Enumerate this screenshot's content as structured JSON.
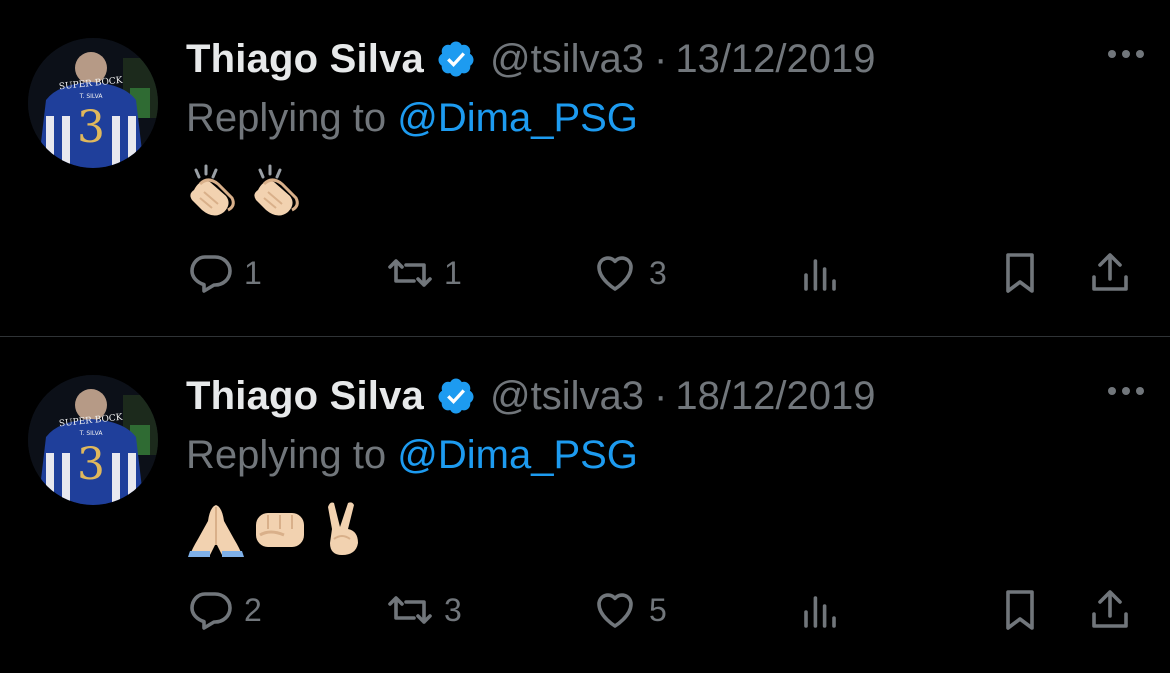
{
  "colors": {
    "background": "#000000",
    "name": "#e7e9ea",
    "muted": "#71767b",
    "accent": "#1d9bf0",
    "divider": "#2f3336"
  },
  "tweets": [
    {
      "author_name": "Thiago Silva",
      "handle": "@tsilva3",
      "separator": "·",
      "date": "13/12/2019",
      "replying_prefix": "Replying to",
      "replying_to": "@Dima_PSG",
      "emojis": [
        "clapping-hands",
        "clapping-hands"
      ],
      "avatar_jersey_text": "SUPER BOCK",
      "avatar_name_text": "T. SILVA",
      "avatar_number": "3",
      "replies": "1",
      "retweets": "1",
      "likes": "3"
    },
    {
      "author_name": "Thiago Silva",
      "handle": "@tsilva3",
      "separator": "·",
      "date": "18/12/2019",
      "replying_prefix": "Replying to",
      "replying_to": "@Dima_PSG",
      "emojis": [
        "folded-hands",
        "oncoming-fist",
        "victory-hand"
      ],
      "avatar_jersey_text": "SUPER BOCK",
      "avatar_name_text": "T. SILVA",
      "avatar_number": "3",
      "replies": "2",
      "retweets": "3",
      "likes": "5"
    }
  ]
}
